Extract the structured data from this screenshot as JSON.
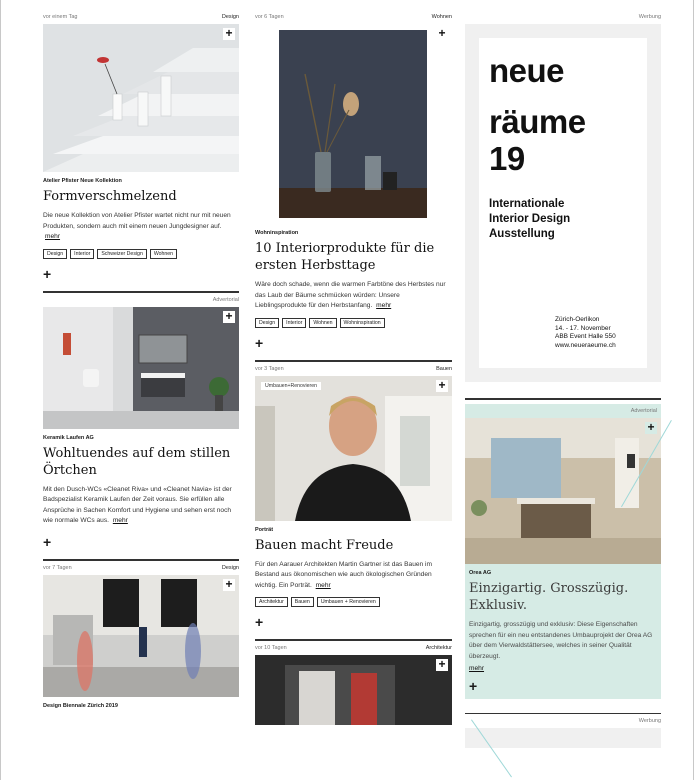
{
  "col1": {
    "item1": {
      "time": "vor einem Tag",
      "category": "Design",
      "kicker": "Atelier Pfister Neue Kollektion",
      "title": "Formverschmelzend",
      "teaser": "Die neue Kollektion von Atelier Pfister wartet nicht nur mit neuen Produkten, sondern auch mit einem neuen Jungdesigner auf.",
      "more": "mehr",
      "tags": [
        "Design",
        "Interior",
        "Schweizer Design",
        "Wohnen"
      ]
    },
    "item2": {
      "label": "Advertorial",
      "kicker": "Keramik Laufen AG",
      "title": "Wohltuendes auf dem stillen Örtchen",
      "teaser": "Mit den Dusch-WCs «Cleanet Riva» und «Cleanet Navia» ist der Badspezialist Keramik Laufen der Zeit voraus. Sie erfüllen alle Ansprüche in Sachen Komfort und Hygiene und sehen erst noch wie normale WCs aus.",
      "more": "mehr"
    },
    "item3": {
      "time": "vor 7 Tagen",
      "category": "Design",
      "kicker": "Design Biennale Zürich 2019"
    }
  },
  "col2": {
    "item1": {
      "time": "vor 6 Tagen",
      "category": "Wohnen",
      "kicker": "Wohninspiration",
      "title": "10 Interiorprodukte für die ersten Herbsttage",
      "teaser": "Wäre doch schade, wenn die warmen Farbtöne des Herbstes nur das Laub der Bäume schmücken würden: Unsere Lieblingsprodukte für den Herbstanfang.",
      "more": "mehr",
      "tags": [
        "Design",
        "Interior",
        "Wohnen",
        "Wohninspiration"
      ]
    },
    "item2": {
      "time": "vor 3 Tagen",
      "category": "Bauen",
      "overlay": "Umbauen+Renovieren",
      "kicker": "Porträt",
      "title": "Bauen macht Freude",
      "teaser": "Für den Aarauer Architekten Martin Gartner ist das Bauen im Bestand aus ökonomischen wie auch ökologischen Gründen wichtig. Ein Porträt.",
      "more": "mehr",
      "tags": [
        "Architektur",
        "Bauen",
        "Umbauen + Renovieren"
      ]
    },
    "item3": {
      "time": "vor 10 Tagen",
      "category": "Architektur"
    }
  },
  "col3": {
    "ad1": {
      "label": "Werbung",
      "line1": "neue",
      "line2": "räume",
      "line3": "19",
      "sub1": "Internationale",
      "sub2": "Interior Design",
      "sub3": "Ausstellung",
      "info1": "Zürich-Oerlikon",
      "info2": "14. - 17. November",
      "info3": "ABB Event Halle 550",
      "info4": "www.neueraeume.ch"
    },
    "item2": {
      "label": "Advertorial",
      "kicker": "Orea AG",
      "title": "Einzigartig. Grosszügig. Exklusiv.",
      "teaser": "Einzigartig, grosszügig und exklusiv: Diese Eigenschaften sprechen für ein neu entstandenes Umbauprojekt der Orea AG über dem Vierwaldstättersee, welches in seiner Qualität überzeugt.",
      "more": "mehr"
    },
    "ad2": {
      "label": "Werbung"
    }
  },
  "plus": "+"
}
